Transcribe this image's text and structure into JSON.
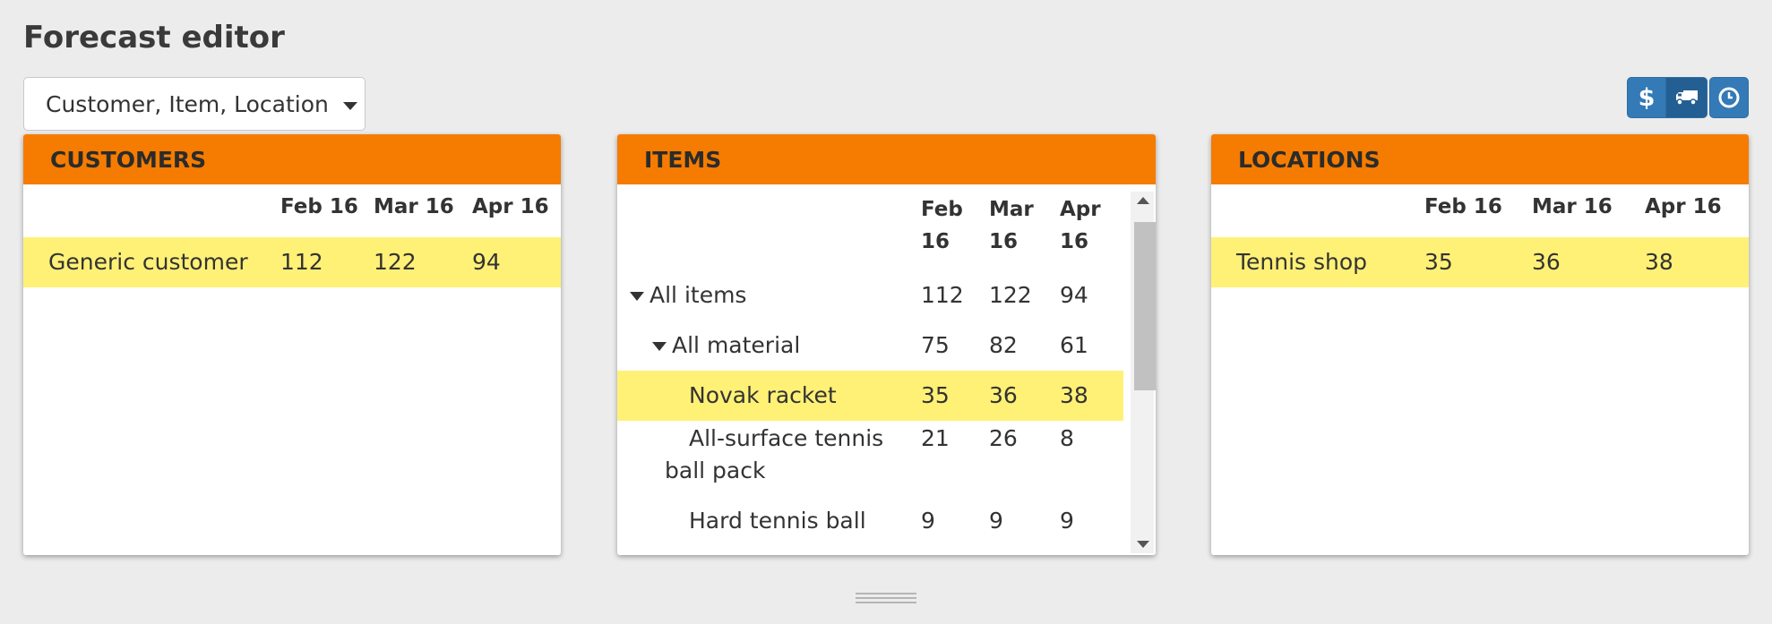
{
  "page_title": "Forecast editor",
  "dimension_select": {
    "value": "Customer, Item, Location"
  },
  "toolbar": {
    "money_label": "$"
  },
  "customers": {
    "header": "CUSTOMERS",
    "columns": [
      "Feb 16",
      "Mar 16",
      "Apr 16"
    ],
    "rows": [
      {
        "name": "Generic customer",
        "values": [
          "112",
          "122",
          "94"
        ]
      }
    ]
  },
  "items": {
    "header": "ITEMS",
    "columns": [
      [
        "Feb",
        "16"
      ],
      [
        "Mar",
        "16"
      ],
      [
        "Apr",
        "16"
      ]
    ],
    "rows": [
      {
        "name": "All items",
        "values": [
          "112",
          "122",
          "94"
        ]
      },
      {
        "name": "All material",
        "values": [
          "75",
          "82",
          "61"
        ]
      },
      {
        "name": "Novak racket",
        "values": [
          "35",
          "36",
          "38"
        ]
      },
      {
        "name_line1": "All-surface tennis",
        "name_line2": "ball pack",
        "values": [
          "21",
          "26",
          "8"
        ]
      },
      {
        "name": "Hard tennis ball",
        "values": [
          "9",
          "9",
          "9"
        ]
      }
    ]
  },
  "locations": {
    "header": "LOCATIONS",
    "columns": [
      "Feb 16",
      "Mar 16",
      "Apr 16"
    ],
    "rows": [
      {
        "name": "Tennis shop",
        "values": [
          "35",
          "36",
          "38"
        ]
      }
    ]
  },
  "colors": {
    "accent": "#f57c00",
    "highlight": "#fff176",
    "button": "#337ab7"
  }
}
